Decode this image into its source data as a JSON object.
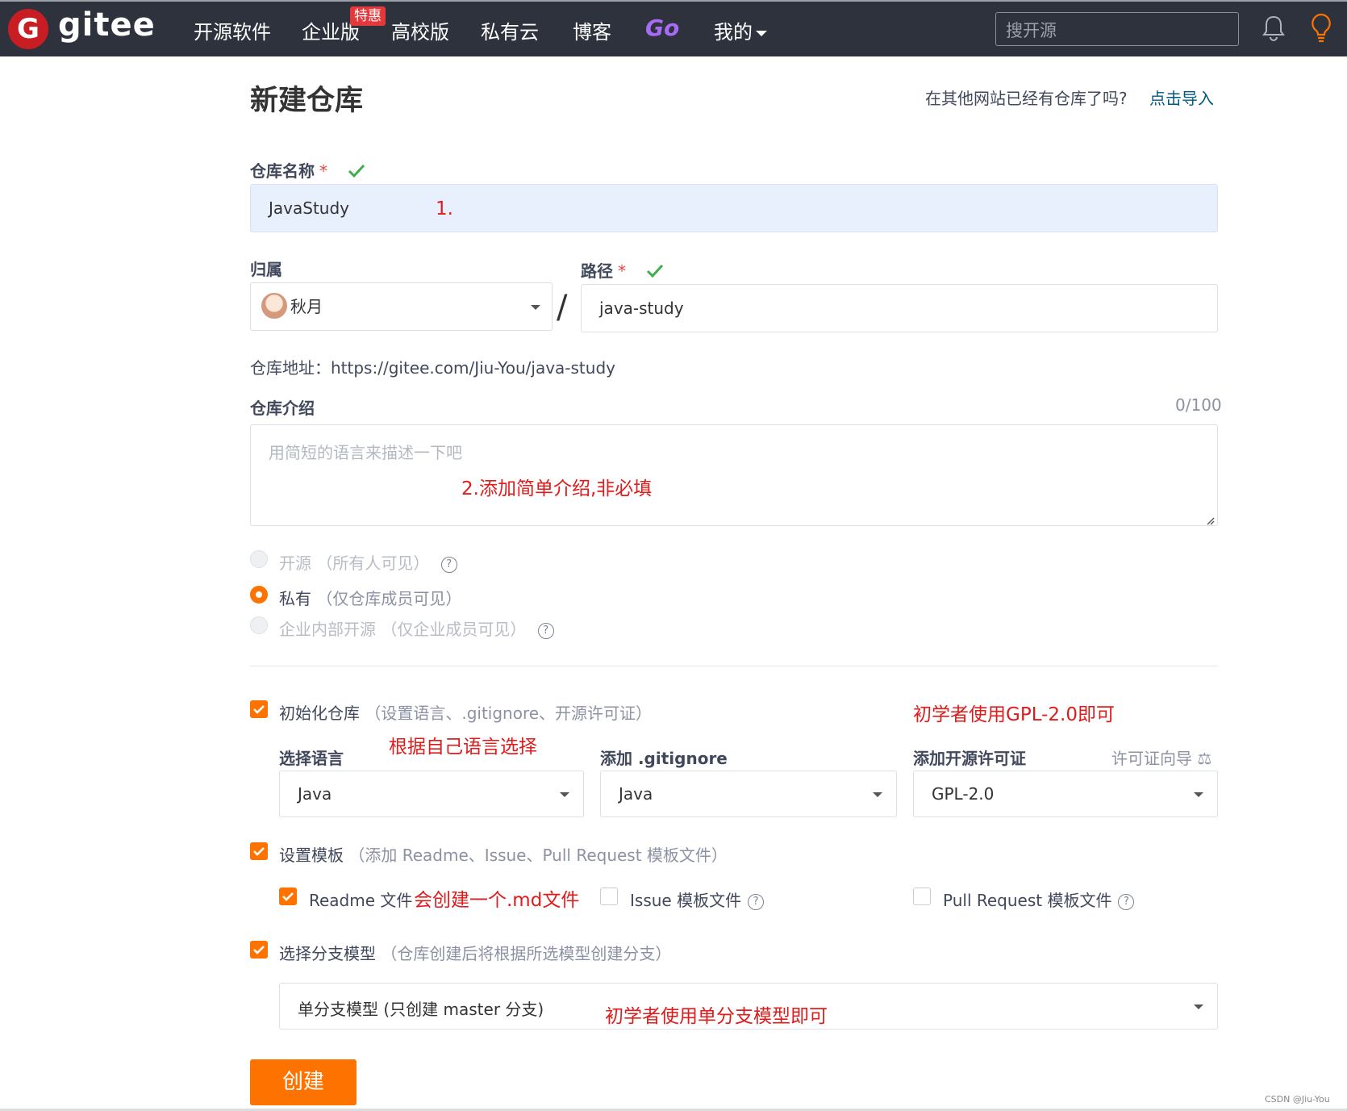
{
  "nav": {
    "brand": "gitee",
    "items": [
      "开源软件",
      "企业版",
      "高校版",
      "私有云",
      "博客"
    ],
    "badge": "特惠",
    "go": "Go",
    "mine": "我的",
    "search_placeholder": "搜开源",
    "icons": [
      "bell-icon",
      "lightbulb-icon"
    ]
  },
  "page": {
    "title": "新建仓库",
    "import_question": "在其他网站已经有仓库了吗?",
    "import_link": "点击导入"
  },
  "form": {
    "name_label": "仓库名称",
    "required_mark": "*",
    "name_value": "JavaStudy",
    "owner_label": "归属",
    "owner_value": "秋月",
    "slash": "/",
    "path_label": "路径",
    "path_value": "java-study",
    "address": "仓库地址：https://gitee.com/Jiu-You/java-study",
    "desc_label": "仓库介绍",
    "desc_counter": "0/100",
    "desc_placeholder": "用简短的语言来描述一下吧",
    "visibility": [
      {
        "label": "开源",
        "hint": "（所有人可见）",
        "selected": false,
        "disabled": true,
        "help": true
      },
      {
        "label": "私有",
        "hint": "（仅仓库成员可见）",
        "selected": true,
        "disabled": false,
        "help": false
      },
      {
        "label": "企业内部开源",
        "hint": "（仅企业成员可见）",
        "selected": false,
        "disabled": true,
        "help": true
      }
    ],
    "init_label": "初始化仓库",
    "init_hint": "（设置语言、.gitignore、开源许可证）",
    "lang_label": "选择语言",
    "lang_value": "Java",
    "gitignore_label": "添加 .gitignore",
    "gitignore_value": "Java",
    "license_label": "添加开源许可证",
    "license_wizard": "许可证向导",
    "license_value": "GPL-2.0",
    "template_label": "设置模板",
    "template_hint": "（添加 Readme、Issue、Pull Request 模板文件）",
    "readme_label": "Readme 文件",
    "issue_label": "Issue 模板文件",
    "pr_label": "Pull Request 模板文件",
    "branch_label": "选择分支模型",
    "branch_hint": "（仓库创建后将根据所选模型创建分支）",
    "branch_value": "单分支模型 (只创建 master 分支)",
    "create_button": "创建"
  },
  "annotations": {
    "a1": "1.",
    "a2": "2.添加简单介绍,非必填",
    "a3": "初学者使用GPL-2.0即可",
    "a4": "根据自己语言选择",
    "a5": "会创建一个.md文件",
    "a6": "初学者使用单分支模型即可"
  },
  "watermark": "CSDN @Jiu-You",
  "colors": {
    "topbar": "#2e323c",
    "accent": "#fe7300",
    "link": "#005980",
    "annotation": "#e01b1b",
    "brand_red": "#c71d23"
  }
}
